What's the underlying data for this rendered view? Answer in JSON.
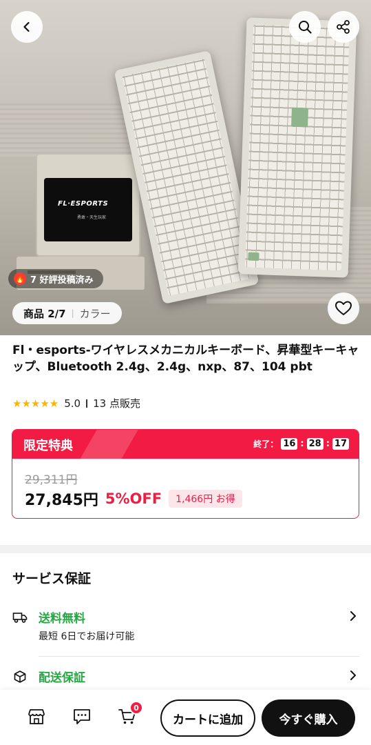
{
  "hero": {
    "monitor_logo_text": "FL·ESPORTS",
    "monitor_sub_text": "勇敢・天生玩家",
    "review_badge": "7 好評投稿済み",
    "counter": "商品 2/7",
    "color_label": "カラー"
  },
  "product": {
    "title": "Fl・esports-ワイヤレスメカニカルキーボード、昇華型キーキャップ、Bluetooth 2.4g、2.4g、nxp、87、104 pbt",
    "stars": "★★★★★",
    "rating": "5.0",
    "sold": "13 点販売"
  },
  "promo": {
    "label": "限定特典",
    "ends_label": "終了：",
    "timer": {
      "h": "16",
      "m": "28",
      "s": "17"
    },
    "original_price": "29,311円",
    "price": "27,845円",
    "discount": "5%OFF",
    "savings": "1,466円 お得"
  },
  "service": {
    "heading": "サービス保証",
    "items": [
      {
        "title": "送料無料",
        "subtitle": "最短 6日でお届け可能"
      },
      {
        "title": "配送保証"
      }
    ]
  },
  "bottom": {
    "cart_count": "0",
    "add_to_cart": "カートに追加",
    "buy_now": "今すぐ購入"
  },
  "colors": {
    "accent_red": "#ee1d42",
    "service_green": "#27a844",
    "star_yellow": "#fbb400"
  }
}
